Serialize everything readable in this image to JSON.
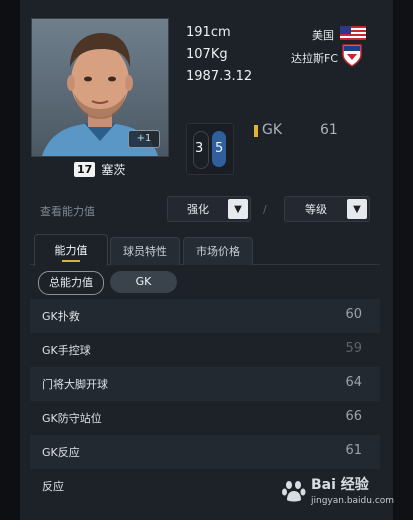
{
  "player": {
    "height": "191cm",
    "weight": "107Kg",
    "birthdate": "1987.3.12",
    "country": "美国",
    "club": "达拉斯FC",
    "number": "17",
    "name": "塞茨",
    "plus": "+1"
  },
  "feet": {
    "left": "3",
    "right": "5"
  },
  "position": {
    "label": "GK",
    "rating": "61"
  },
  "controls": {
    "view_label": "查看能力值",
    "enhance": "强化",
    "grade": "等级",
    "separator": "/"
  },
  "tabs": [
    {
      "label": "能力值"
    },
    {
      "label": "球员特性"
    },
    {
      "label": "市场价格"
    }
  ],
  "filters": {
    "total": "总能力值",
    "gk": "GK"
  },
  "attributes": [
    {
      "label": "GK扑救",
      "value": "60"
    },
    {
      "label": "GK手控球",
      "value": "59"
    },
    {
      "label": "门将大脚开球",
      "value": "64"
    },
    {
      "label": "GK防守站位",
      "value": "66"
    },
    {
      "label": "GK反应",
      "value": "61"
    },
    {
      "label": "反应",
      "value": ""
    }
  ],
  "watermark": {
    "main": "Bai 经验",
    "sub": "jingyan.baidu.com"
  },
  "colors": {
    "accent": "#d9b23b",
    "panel": "#1d2229",
    "foot_strong": "#2f5f9c"
  }
}
